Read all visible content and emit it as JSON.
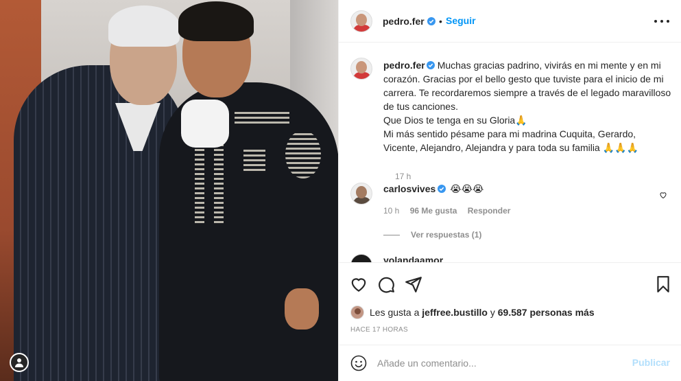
{
  "header": {
    "username": "pedro.fer",
    "separator": "•",
    "follow_label": "Seguir",
    "more_icon": "more-options-icon"
  },
  "caption": {
    "username": "pedro.fer",
    "text": "Muchas gracias padrino, vivirás en mi mente y en mi corazón. Gracias por el bello gesto que tuviste para el inicio de mi carrera. Te recordaremos siempre a través de el legado maravilloso de tus canciones.",
    "line2": "Que Dios te tenga en su Gloria🙏",
    "line3": "Mi más sentido pésame para mi madrina Cuquita, Gerardo, Vicente, Alejandro, Alejandra y para toda su familia 🙏🙏🙏",
    "time": "17 h"
  },
  "comments": [
    {
      "username": "carlosvives",
      "text": "😭😭😭",
      "time": "10 h",
      "likes": "96 Me gusta",
      "reply_label": "Responder",
      "view_replies": "Ver respuestas (1)"
    },
    {
      "username": "yolandaamor",
      "text": "🖤😢"
    }
  ],
  "actions": {
    "likes_prefix": "Les gusta a",
    "likes_user": "jeffree.bustillo",
    "likes_and": "y",
    "likes_count": "69.587 personas más",
    "time_ago": "HACE 17 HORAS"
  },
  "add_comment": {
    "placeholder": "Añade un comentario...",
    "publish_label": "Publicar"
  },
  "colors": {
    "accent": "#0095f6",
    "publish_disabled": "#b2dffc",
    "muted": "#8e8e8e"
  }
}
